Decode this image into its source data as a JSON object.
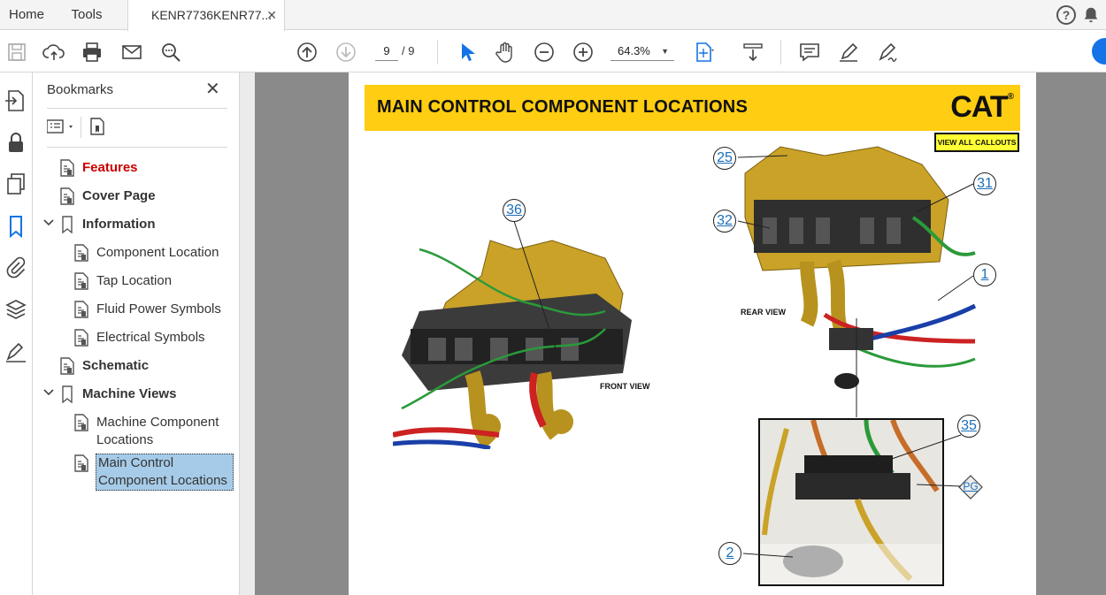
{
  "tabs": {
    "home": "Home",
    "tools": "Tools",
    "document": "KENR7736KENR77...",
    "close": "✕"
  },
  "toolbar": {
    "page_current": "9",
    "page_total": "/ 9",
    "zoom": "64.3%"
  },
  "bookmarks": {
    "title": "Bookmarks",
    "close": "✕",
    "items": [
      {
        "label": "Features"
      },
      {
        "label": "Cover Page"
      },
      {
        "label": "Information"
      },
      {
        "label": "Component Location"
      },
      {
        "label": "Tap Location"
      },
      {
        "label": "Fluid Power Symbols"
      },
      {
        "label": "Electrical Symbols"
      },
      {
        "label": "Schematic"
      },
      {
        "label": "Machine Views"
      },
      {
        "label": "Machine Component Locations"
      },
      {
        "label": "Main Control Component Locations"
      }
    ]
  },
  "page": {
    "title": "MAIN CONTROL COMPONENT LOCATIONS",
    "logo": "CAT",
    "logo_mark": "®",
    "view_all_callouts": "VIEW ALL CALLOUTS",
    "front_view": "FRONT VIEW",
    "rear_view": "REAR  VIEW",
    "callouts": [
      "36",
      "25",
      "31",
      "32",
      "1",
      "35",
      "PG",
      "2"
    ]
  },
  "colors": {
    "banner": "#ffcd11",
    "callout_text": "#1b6fb8",
    "selected_bookmark": "#a6cbe8",
    "features_red": "#cc0000",
    "gutter": "#8a8a8a"
  }
}
